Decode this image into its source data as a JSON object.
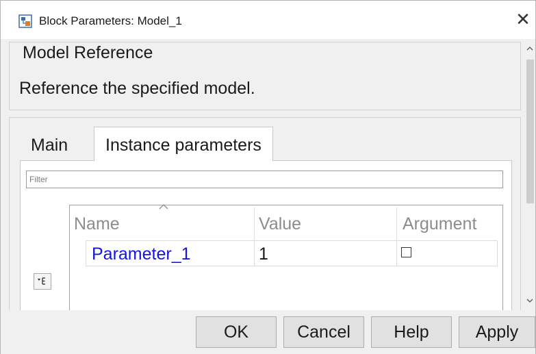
{
  "window": {
    "title": "Block Parameters: Model_1",
    "close_glyph": "✕"
  },
  "description": {
    "heading": "Model Reference",
    "text": "Reference the specified model."
  },
  "tabs": [
    {
      "label": "Main",
      "selected": false
    },
    {
      "label": "Instance parameters",
      "selected": true
    }
  ],
  "filter": {
    "placeholder": "Filter",
    "value": ""
  },
  "table": {
    "columns": [
      "Name",
      "Value",
      "Argument"
    ],
    "sorted_column": "Name",
    "rows": [
      {
        "name": "Parameter_1",
        "value": "1",
        "argument_checked": false
      }
    ]
  },
  "icons": {
    "app": "block-parameters-icon",
    "list_button": "list-view-icon",
    "sort": "sort-ascending-icon"
  },
  "buttons": {
    "ok": "OK",
    "cancel": "Cancel",
    "help": "Help",
    "apply": "Apply"
  },
  "colors": {
    "parameter_link": "#1414e0",
    "dialog_background": "#f0f0f0"
  }
}
